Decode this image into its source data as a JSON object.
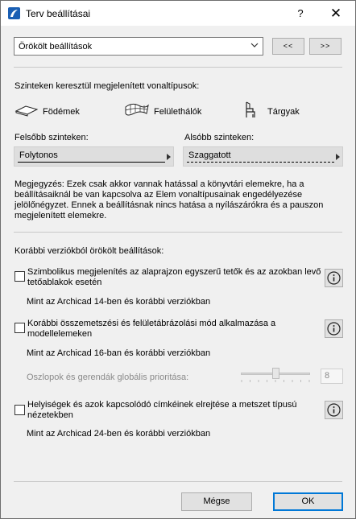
{
  "window": {
    "title": "Terv beállításai",
    "help": "?",
    "close": "✕"
  },
  "preset": {
    "value": "Örökölt beállítások",
    "prev": "<<",
    "next": ">>"
  },
  "linetypes": {
    "heading": "Szinteken keresztül megjelenített vonaltípusok:",
    "categories": [
      "Födémek",
      "Felülethálók",
      "Tárgyak"
    ],
    "upper_label": "Felsőbb szinteken:",
    "upper_value": "Folytonos",
    "lower_label": "Alsóbb szinteken:",
    "lower_value": "Szaggatott"
  },
  "note": "Megjegyzés: Ezek csak akkor vannak hatással a könyvtári elemekre, ha a beállításaiknál be van kapcsolva az Elem vonaltípusainak engedélyezése jelölőnégyzet. Ennek a beállításnak nincs hatása a nyílászárókra és a pauszon megjelenített elemekre.",
  "legacy": {
    "heading": "Korábbi verziókból örökölt beállítások:",
    "options": [
      {
        "label": "Szimbolikus megjelenítés az alaprajzon egyszerű tetők és az azokban levő tetőablakok esetén",
        "checked": false,
        "sub": "Mint az Archicad 14-ben és korábbi verziókban"
      },
      {
        "label": "Korábbi összemetszési és felületábrázolási mód alkalmazása a modellelemeken",
        "checked": false,
        "sub": "Mint az Archicad 16-ban és korábbi verziókban"
      },
      {
        "label": "Helyiségek és azok kapcsolódó címkéinek elrejtése a metszet típusú nézetekben",
        "checked": false,
        "sub": "Mint az Archicad 24-ben és korábbi verziókban"
      }
    ],
    "priority_label": "Oszlopok és gerendák globális prioritása:",
    "priority_value": "8",
    "priority_slider": 0.5
  },
  "buttons": {
    "cancel": "Mégse",
    "ok": "OK"
  },
  "colors": {
    "accent": "#0078d7",
    "appicon": "#1a5fb4"
  }
}
